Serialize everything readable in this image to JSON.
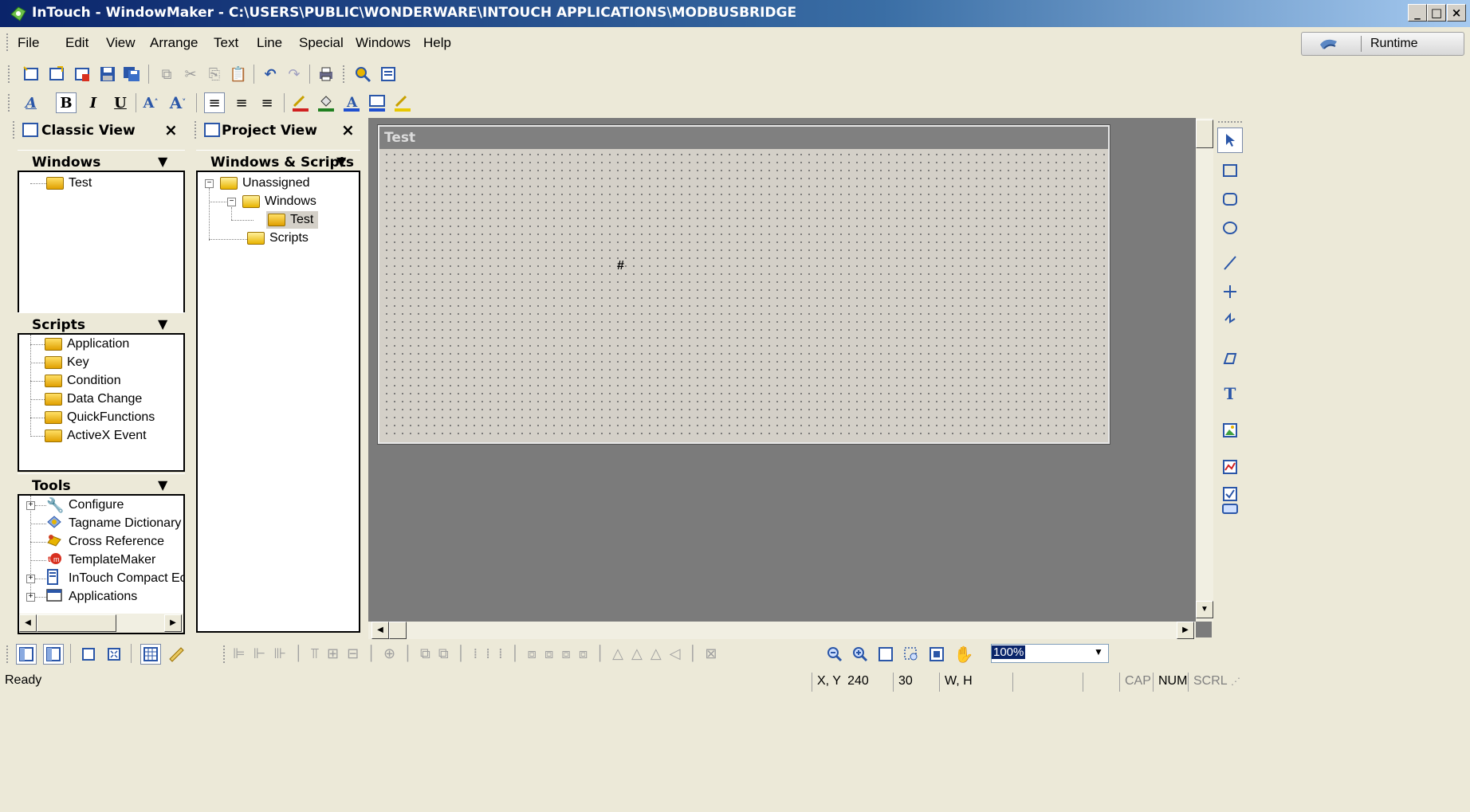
{
  "window": {
    "title": "InTouch - WindowMaker - C:\\USERS\\PUBLIC\\WONDERWARE\\INTOUCH APPLICATIONS\\MODBUSBRIDGE",
    "minimize": "_",
    "maximize": "□",
    "close": "×"
  },
  "menu": {
    "items": [
      "File",
      "Edit",
      "View",
      "Arrange",
      "Text",
      "Line",
      "Special",
      "Windows",
      "Help"
    ]
  },
  "runtime_button": {
    "label": "Runtime"
  },
  "classic_view": {
    "title": "Classic View",
    "close": "×",
    "windows_header": "Windows",
    "windows_items": [
      "Test"
    ],
    "scripts_header": "Scripts",
    "scripts_items": [
      "Application",
      "Key",
      "Condition",
      "Data Change",
      "QuickFunctions",
      "ActiveX Event"
    ],
    "tools_header": "Tools",
    "tools_items": [
      "Configure",
      "Tagname Dictionary",
      "Cross Reference",
      "TemplateMaker",
      "InTouch Compact Ec",
      "Applications"
    ]
  },
  "project_view": {
    "title": "Project View",
    "close": "×",
    "header": "Windows & Scripts",
    "tree": {
      "root": "Unassigned",
      "windows": "Windows",
      "window_item": "Test",
      "scripts": "Scripts"
    }
  },
  "canvas": {
    "window_title": "Test",
    "marker": "#"
  },
  "zoom": {
    "value": "100%"
  },
  "status": {
    "ready": "Ready",
    "xy_label": "X, Y",
    "x_value": "240",
    "y_value": "30",
    "wh_label": "W, H",
    "cap": "CAP",
    "num": "NUM",
    "scrl": "SCRL"
  },
  "colors": {
    "titlebar_start": "#0a246a",
    "titlebar_end": "#a6caf0",
    "canvas_bg": "#7b7b7b",
    "window_bg": "#d4d0c8"
  }
}
